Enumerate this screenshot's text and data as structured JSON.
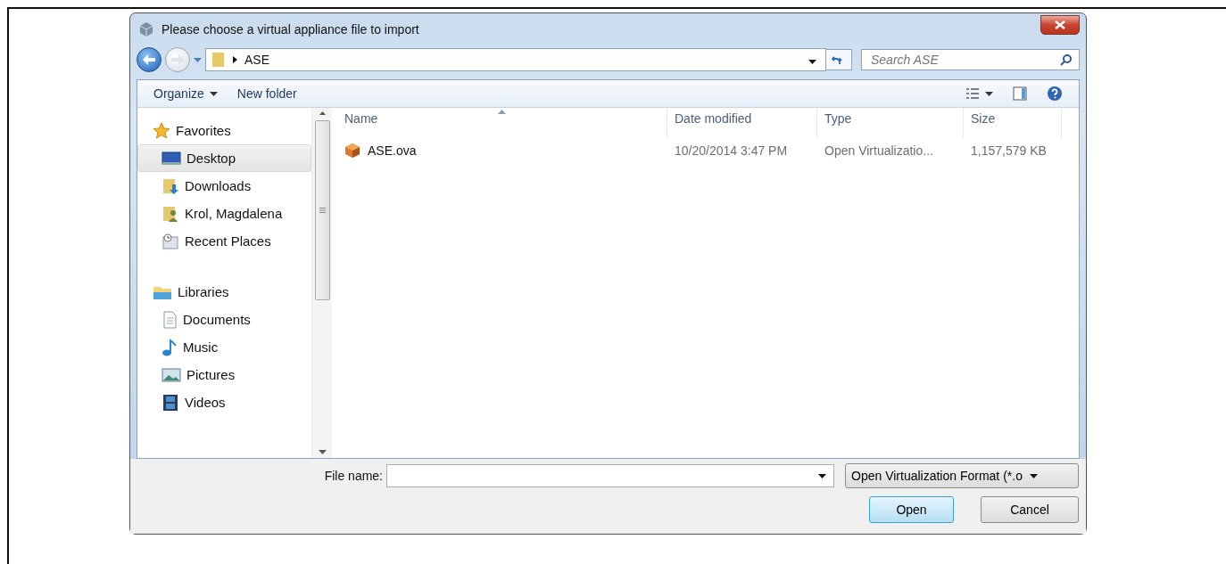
{
  "window": {
    "title": "Please choose a virtual appliance file to import"
  },
  "address_bar": {
    "path": "ASE"
  },
  "search": {
    "placeholder": "Search ASE"
  },
  "toolbar": {
    "organize": "Organize",
    "new_folder": "New folder"
  },
  "sidebar": {
    "groups": [
      {
        "label": "Favorites",
        "kind": "favorites",
        "children": [
          {
            "label": "Desktop",
            "kind": "desktop",
            "selected": true
          },
          {
            "label": "Downloads",
            "kind": "downloads",
            "selected": false
          },
          {
            "label": "Krol, Magdalena",
            "kind": "user",
            "selected": false
          },
          {
            "label": "Recent Places",
            "kind": "recent",
            "selected": false
          }
        ]
      },
      {
        "label": "Libraries",
        "kind": "libraries",
        "children": [
          {
            "label": "Documents",
            "kind": "documents",
            "selected": false
          },
          {
            "label": "Music",
            "kind": "music",
            "selected": false
          },
          {
            "label": "Pictures",
            "kind": "pictures",
            "selected": false
          },
          {
            "label": "Videos",
            "kind": "videos",
            "selected": false
          }
        ]
      }
    ]
  },
  "table": {
    "columns": [
      "Name",
      "Date modified",
      "Type",
      "Size"
    ],
    "rows": [
      {
        "name": "ASE.ova",
        "date_modified": "10/20/2014 3:47 PM",
        "type": "Open Virtualizatio...",
        "size": "1,157,579 KB"
      }
    ]
  },
  "file_name": {
    "label": "File name:"
  },
  "file_type": {
    "value": "Open Virtualization Format (*.o"
  },
  "buttons": [
    {
      "label": "Open",
      "default": true
    },
    {
      "label": "Cancel",
      "default": false
    }
  ]
}
